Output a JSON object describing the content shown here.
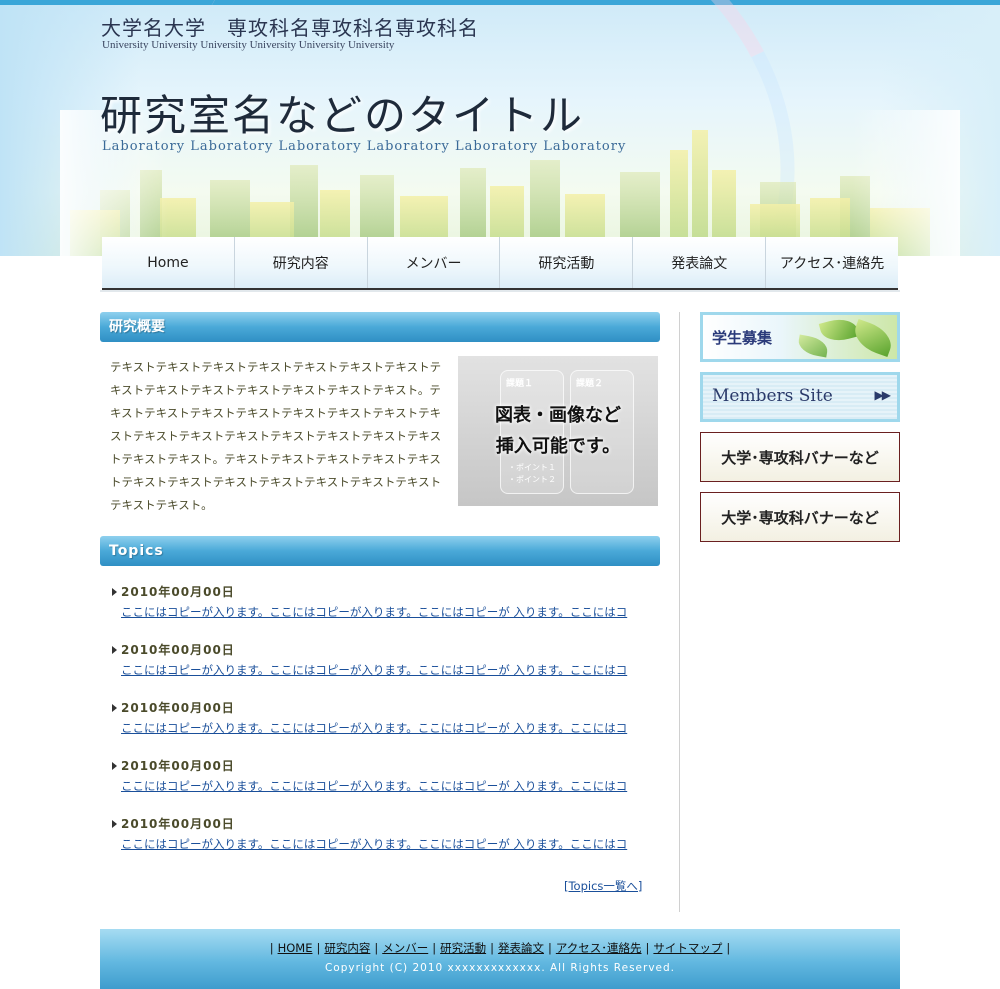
{
  "header": {
    "university": "大学名大学　専攻科名専攻科名専攻科名",
    "university_sub": "University University University University University University",
    "lab_title": "研究室名などのタイトル",
    "lab_sub": "Laboratory Laboratory  Laboratory Laboratory Laboratory Laboratory"
  },
  "nav": {
    "items": [
      {
        "label": "Home"
      },
      {
        "label": "研究内容"
      },
      {
        "label": "メンバー"
      },
      {
        "label": "研究活動"
      },
      {
        "label": "発表論文"
      },
      {
        "label": "アクセス･連絡先"
      }
    ]
  },
  "overview": {
    "heading": "研究概要",
    "text": "テキストテキストテキストテキストテキストテキストテキストテキストテキストテキストテキストテキストテキストテキスト。テキストテキストテキストテキストテキストテキストテキストテキストテキストテキストテキストテキストテキストテキストテキストテキストテキスト。テキストテキストテキストテキストテキストテキストテキストテキストテキストテキストテキストテキストテキストテキスト。",
    "figure_caption_1": "図表・画像など",
    "figure_caption_2": "挿入可能です。",
    "figure_label_1": "課題１",
    "figure_label_2": "課題２",
    "figure_point_1": "・ポイント１",
    "figure_point_2": "・ポイント２"
  },
  "topics": {
    "heading": "Topics",
    "items": [
      {
        "date": "2010年00月00日",
        "text": "ここにはコピーが入ります。ここにはコピーが入ります。ここにはコピーが 入ります。ここにはコ"
      },
      {
        "date": "2010年00月00日",
        "text": "ここにはコピーが入ります。ここにはコピーが入ります。ここにはコピーが 入ります。ここにはコ"
      },
      {
        "date": "2010年00月00日",
        "text": "ここにはコピーが入ります。ここにはコピーが入ります。ここにはコピーが 入ります。ここにはコ"
      },
      {
        "date": "2010年00月00日",
        "text": "ここにはコピーが入ります。ここにはコピーが入ります。ここにはコピーが 入ります。ここにはコ"
      },
      {
        "date": "2010年00月00日",
        "text": "ここにはコピーが入ります。ここにはコピーが入ります。ここにはコピーが 入ります。ここにはコ"
      }
    ],
    "more_link": "[Topics一覧へ]"
  },
  "sidebar": {
    "recruit": "学生募集",
    "members": "Members Site",
    "members_arrows": "▶▶",
    "univ_banner_1": "大学･専攻科バナーなど",
    "univ_banner_2": "大学･専攻科バナーなど"
  },
  "footer": {
    "links": [
      "HOME",
      "研究内容",
      "メンバー",
      "研究活動",
      "発表論文",
      "アクセス･連絡先",
      "サイトマップ"
    ],
    "separator": "|",
    "copyright": "Copyright (C) 2010 xxxxxxxxxxxxx. All Rights Reserved."
  },
  "colors": {
    "accent": "#3aa6d8",
    "link": "#1a4f9a",
    "heading_bar": "#4aa9d8"
  }
}
